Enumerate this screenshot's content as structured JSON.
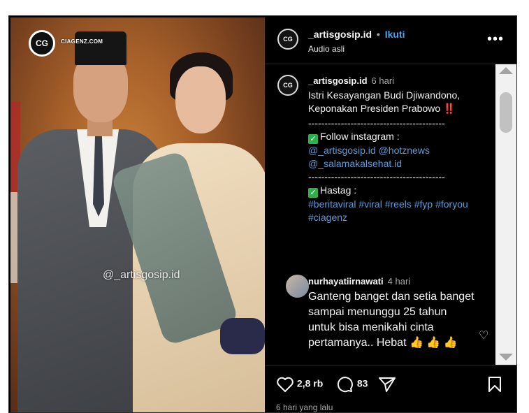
{
  "photo": {
    "logo_mark": "CIAGENZ",
    "logo_text": "CIAGENZ.COM",
    "watermark": "@_artisgosip.id"
  },
  "header": {
    "username": "_artisgosip.id",
    "dot": "•",
    "follow_label": "Ikuti",
    "audio": "Audio asli",
    "more_icon": "more-horizontal-icon"
  },
  "caption": {
    "username": "_artisgosip.id",
    "time": "6 hari",
    "line1": "Istri Kesayangan Budi Djiwandono, Keponakan Presiden Prabowo",
    "exclaim": "‼️",
    "divider1": "------------------------------------------",
    "follow_label": "Follow instagram :",
    "follow_accounts": "@_artisgosip.id @hotznews @_salamakalsehat.id",
    "divider2": "------------------------------------------",
    "hastag_label": "Hastag :",
    "hashtags": "#beritaviral #viral #reels #fyp #foryou #ciagenz"
  },
  "comment": {
    "username": "nurhayatiirnawati",
    "time": "4 hari",
    "text": "Ganteng banget dan setia banget sampai menunggu 25 tahun untuk bisa menikahi cinta pertamanya.. Hebat 👍 👍 👍"
  },
  "actions": {
    "likes": "2,8 rb",
    "comments": "83",
    "post_date": "6 hari yang lalu"
  }
}
